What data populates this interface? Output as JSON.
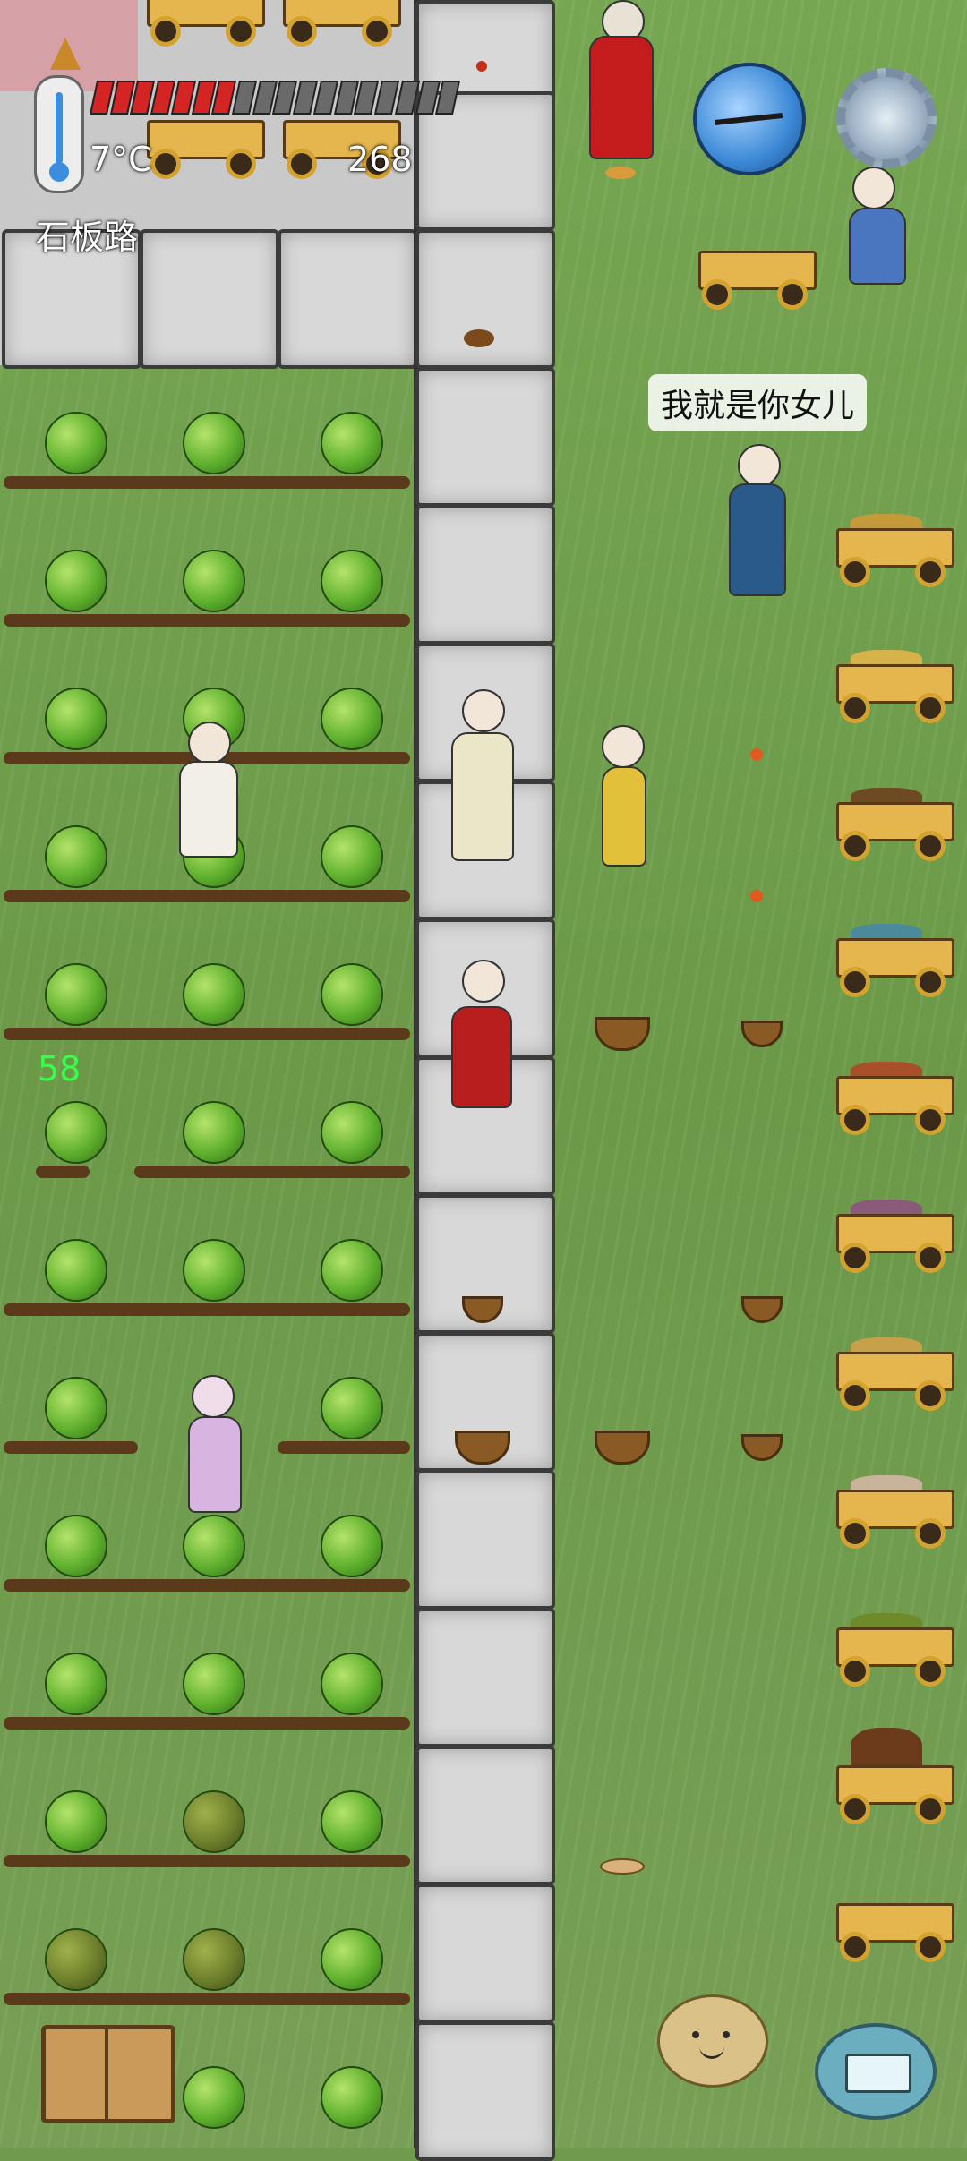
{
  "hud": {
    "temperature": "7°C",
    "score": "268",
    "location": "石板路",
    "food_pips_total": 18,
    "food_pips_full": 7,
    "age_counter": "58"
  },
  "speech_bubble": "我就是你女儿",
  "icons": {
    "thermometer": "thermometer-icon",
    "compass": "compass-icon",
    "settings": "gear-icon",
    "book": "book-icon",
    "emote": "potato-face-icon",
    "keyboard": "keyboard-icon"
  },
  "colors": {
    "food_full": "#d42424",
    "food_empty": "#6a6a6a",
    "age_counter": "#36ff4a",
    "grass": "#6f9a4c"
  }
}
